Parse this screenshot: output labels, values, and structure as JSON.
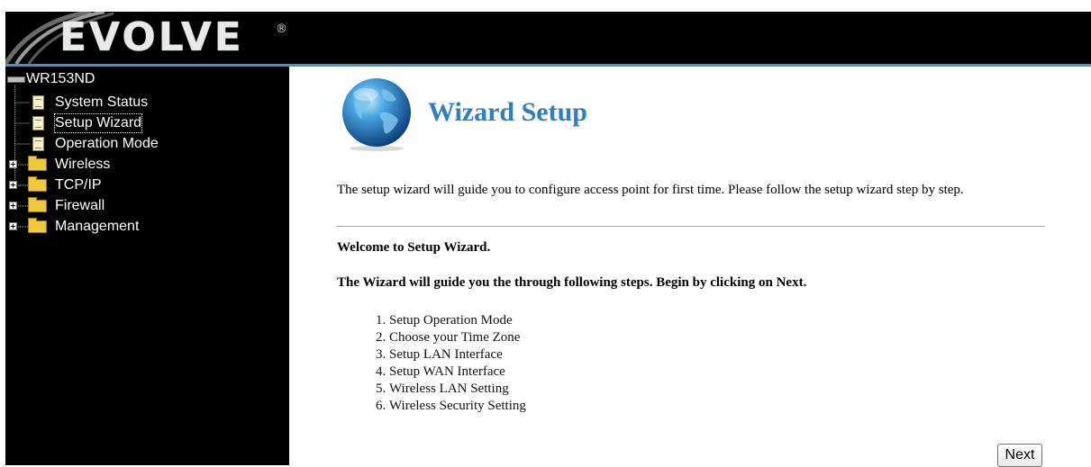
{
  "header": {
    "logo": "EVOLVE",
    "logo_mark": "®"
  },
  "sidebar": {
    "root": {
      "label": "WR153ND",
      "icon": "router-icon"
    },
    "items": [
      {
        "label": "System Status",
        "icon": "document-icon",
        "expandable": false
      },
      {
        "label": "Setup Wizard",
        "icon": "document-icon",
        "expandable": false,
        "selected": true
      },
      {
        "label": "Operation Mode",
        "icon": "document-icon",
        "expandable": false
      },
      {
        "label": "Wireless",
        "icon": "folder-icon",
        "expandable": true
      },
      {
        "label": "TCP/IP",
        "icon": "folder-icon",
        "expandable": true
      },
      {
        "label": "Firewall",
        "icon": "folder-icon",
        "expandable": true
      },
      {
        "label": "Management",
        "icon": "folder-icon",
        "expandable": true
      }
    ]
  },
  "main": {
    "title": "Wizard Setup",
    "intro": "The setup wizard will guide you to configure access point for first time. Please follow the setup wizard step by step.",
    "welcome": "Welcome to Setup Wizard.",
    "guide": "The Wizard will guide you the through following steps. Begin by clicking on Next.",
    "steps": [
      "Setup Operation Mode",
      "Choose your Time Zone",
      "Setup LAN Interface",
      "Setup WAN Interface",
      "Wireless LAN Setting",
      "Wireless Security Setting"
    ],
    "next_label": "Next"
  },
  "colors": {
    "title": "#2f7fbf",
    "header_rule": "#3f95c8",
    "sidebar_bg": "#000000"
  }
}
